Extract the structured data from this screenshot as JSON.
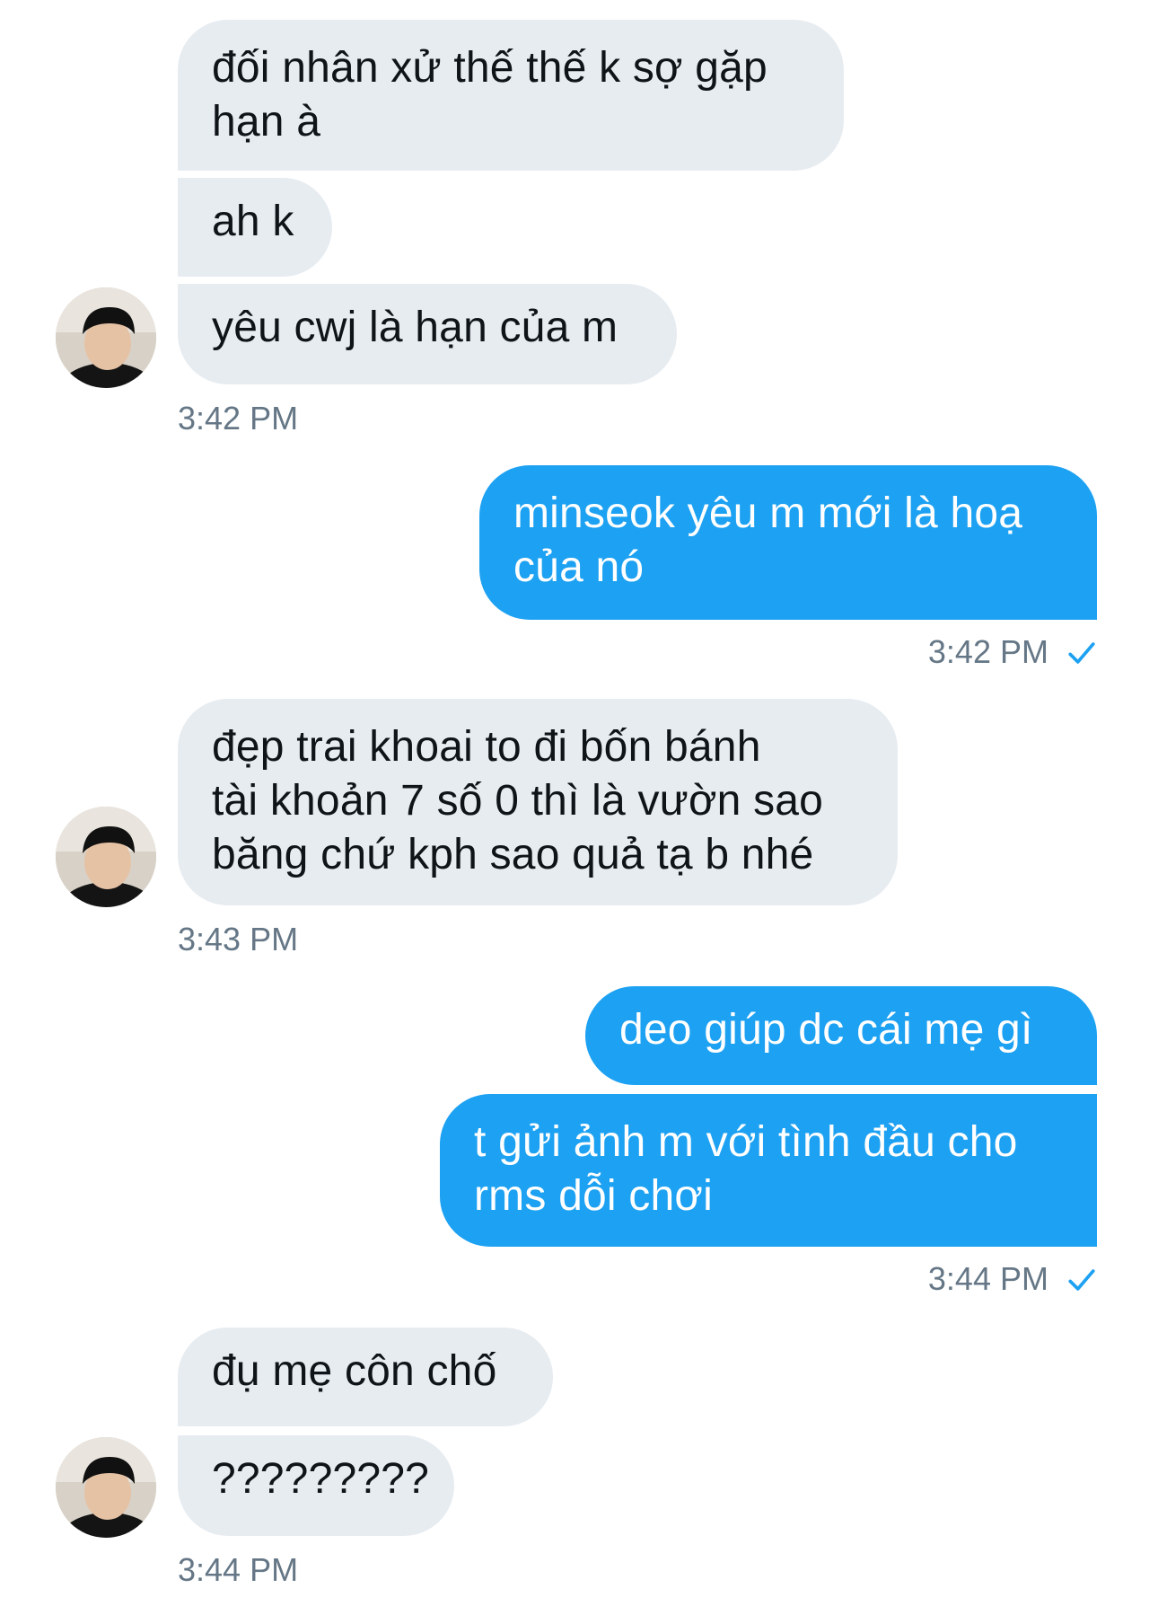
{
  "messages": [
    {
      "text": "đối nhân xử thế thế k sợ gặp\nhạn à"
    },
    {
      "text": "ah k"
    },
    {
      "text": "yêu cwj là hạn của m"
    },
    {
      "time": "3:42 PM"
    },
    {
      "text": "minseok yêu m mới là hoạ\ncủa nó"
    },
    {
      "time": "3:42 PM"
    },
    {
      "text": "đẹp trai khoai to đi bốn bánh\ntài khoản 7 số 0 thì là vườn sao\nbăng chứ kph sao quả tạ b nhé"
    },
    {
      "time": "3:43 PM"
    },
    {
      "text": "deo giúp dc cái mẹ gì"
    },
    {
      "text": "t gửi ảnh m với tình đầu cho\nrms dỗi chơi"
    },
    {
      "time": "3:44 PM"
    },
    {
      "text": "đụ mẹ côn chố"
    },
    {
      "text": "?????????"
    },
    {
      "time": "3:44 PM"
    }
  ],
  "colors": {
    "incoming_bubble": "#e7ecf1",
    "outgoing_bubble": "#1da1f2",
    "timestamp": "#657786",
    "read_check": "#1da1f2"
  },
  "icons": {
    "sent_status": "checkmark-icon",
    "avatar": "user-avatar-photo"
  }
}
